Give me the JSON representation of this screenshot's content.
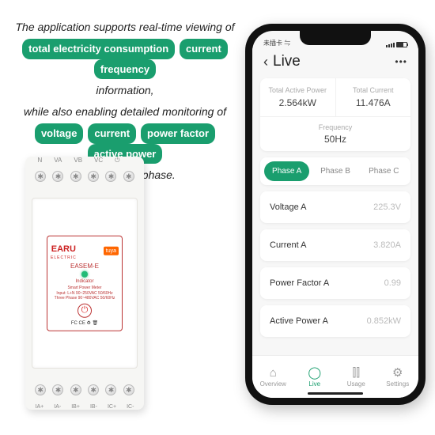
{
  "promo": {
    "line1": "The application supports real-time viewing of",
    "pill1": "total electricity consumption",
    "pill2": "current",
    "pill3": "frequency",
    "line2": "information,",
    "line3": "while also enabling detailed monitoring of",
    "pill4": "voltage",
    "pill5": "current",
    "pill6": "power factor",
    "pill7": "active power",
    "line4": "data for each phase."
  },
  "device": {
    "top_labels": [
      "N",
      "VA",
      "VB",
      "VC",
      "⏻",
      ""
    ],
    "brand": "EARU",
    "brand_sub": "ELECTRIC",
    "partner": "tuya",
    "model": "EASEM-E",
    "indicator": "Indicator",
    "spec_title": "Smart Power Meter",
    "spec_line1": "Input: L+N 90~250VAC 50/60Hz",
    "spec_line2": "Three Phase 90~480VAC 50/60Hz",
    "cert": "FC CE ♻ 🗑",
    "bot_labels": [
      "IA+",
      "IA-",
      "IB+",
      "IB-",
      "IC+",
      "IC-"
    ]
  },
  "app": {
    "status_left": "未插卡 ⇋",
    "header": {
      "title": "Live",
      "more": "•••"
    },
    "summary": {
      "power_label": "Total Active Power",
      "power_value": "2.564kW",
      "current_label": "Total Current",
      "current_value": "11.476A",
      "freq_label": "Frequency",
      "freq_value": "50Hz"
    },
    "tabs": [
      "Phase A",
      "Phase B",
      "Phase C"
    ],
    "metrics": [
      {
        "label": "Voltage A",
        "value": "225.3V"
      },
      {
        "label": "Current A",
        "value": "3.820A"
      },
      {
        "label": "Power Factor A",
        "value": "0.99"
      },
      {
        "label": "Active Power A",
        "value": "0.852kW"
      }
    ],
    "nav": [
      {
        "icon": "⌂",
        "label": "Overview"
      },
      {
        "icon": "◯",
        "label": "Live"
      },
      {
        "icon": "⫿⫿",
        "label": "Usage"
      },
      {
        "icon": "⚙",
        "label": "Settings"
      }
    ]
  }
}
